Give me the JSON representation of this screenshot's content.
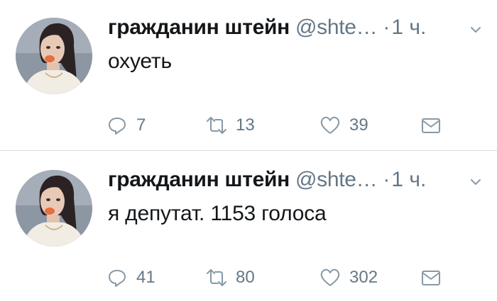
{
  "tweets": [
    {
      "author_name": "гражданин штейн",
      "handle": "@shte…",
      "separator": "·",
      "time": "1 ч.",
      "text": "охуеть",
      "replies": "7",
      "retweets": "13",
      "likes": "39"
    },
    {
      "author_name": "гражданин штейн",
      "handle": "@shte…",
      "separator": "·",
      "time": "1 ч.",
      "text": "я депутат. 1153 голоса",
      "replies": "41",
      "retweets": "80",
      "likes": "302"
    }
  ],
  "colors": {
    "text": "#14171a",
    "secondary": "#657786",
    "divider": "#d9dee3",
    "avatar_bg": "#7f8a99"
  },
  "icons": {
    "reply": "reply-icon",
    "retweet": "retweet-icon",
    "like": "heart-icon",
    "dm": "envelope-icon",
    "menu": "chevron-down-icon"
  }
}
